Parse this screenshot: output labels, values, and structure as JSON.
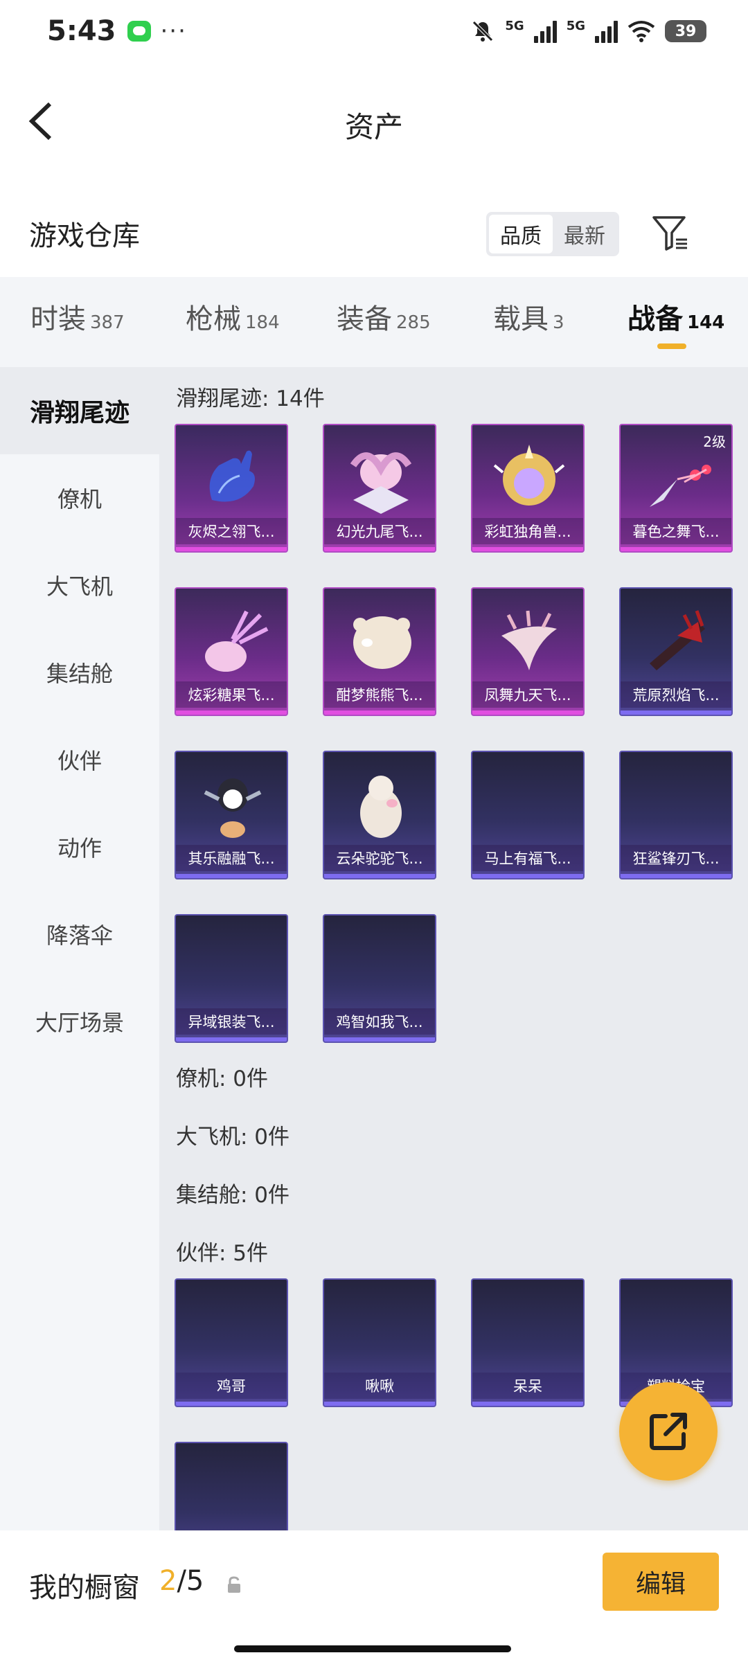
{
  "status_bar": {
    "time": "5:43",
    "dots": "···",
    "network1": "5G",
    "network2": "5G",
    "battery": "39"
  },
  "header": {
    "title": "资产"
  },
  "warehouse": {
    "title": "游戏仓库",
    "sort_options": [
      "品质",
      "最新"
    ]
  },
  "category_tabs": [
    {
      "label": "时装",
      "count": "387"
    },
    {
      "label": "枪械",
      "count": "184"
    },
    {
      "label": "装备",
      "count": "285"
    },
    {
      "label": "载具",
      "count": "3"
    },
    {
      "label": "战备",
      "count": "144"
    }
  ],
  "sidebar": [
    {
      "label": "滑翔尾迹"
    },
    {
      "label": "僚机"
    },
    {
      "label": "大飞机"
    },
    {
      "label": "集结舱"
    },
    {
      "label": "伙伴"
    },
    {
      "label": "动作"
    },
    {
      "label": "降落伞"
    },
    {
      "label": "大厅场景"
    }
  ],
  "sections": {
    "trail_label": "滑翔尾迹: 14件",
    "wingman_label": "僚机: 0件",
    "plane_label": "大飞机: 0件",
    "pod_label": "集结舱: 0件",
    "partner_label": "伙伴: 5件"
  },
  "trail_items": [
    {
      "name": "灰烬之翎飞...",
      "level": ""
    },
    {
      "name": "幻光九尾飞...",
      "level": ""
    },
    {
      "name": "彩虹独角兽...",
      "level": ""
    },
    {
      "name": "暮色之舞飞...",
      "level": "2级"
    },
    {
      "name": "炫彩糖果飞...",
      "level": ""
    },
    {
      "name": "酣梦熊熊飞...",
      "level": ""
    },
    {
      "name": "凤舞九天飞...",
      "level": ""
    },
    {
      "name": "荒原烈焰飞...",
      "level": ""
    },
    {
      "name": "其乐融融飞...",
      "level": ""
    },
    {
      "name": "云朵驼驼飞...",
      "level": ""
    },
    {
      "name": "马上有福飞...",
      "level": ""
    },
    {
      "name": "狂鲨锋刃飞...",
      "level": ""
    },
    {
      "name": "异域银装飞...",
      "level": ""
    },
    {
      "name": "鸡智如我飞...",
      "level": ""
    }
  ],
  "partner_items": [
    {
      "name": "鸡哥"
    },
    {
      "name": "啾啾"
    },
    {
      "name": "呆呆"
    },
    {
      "name": "塑料捡宝"
    },
    {
      "name": ""
    }
  ],
  "bottom_bar": {
    "window_label": "我的橱窗",
    "current": "2",
    "total": "/5",
    "edit_label": "编辑"
  }
}
